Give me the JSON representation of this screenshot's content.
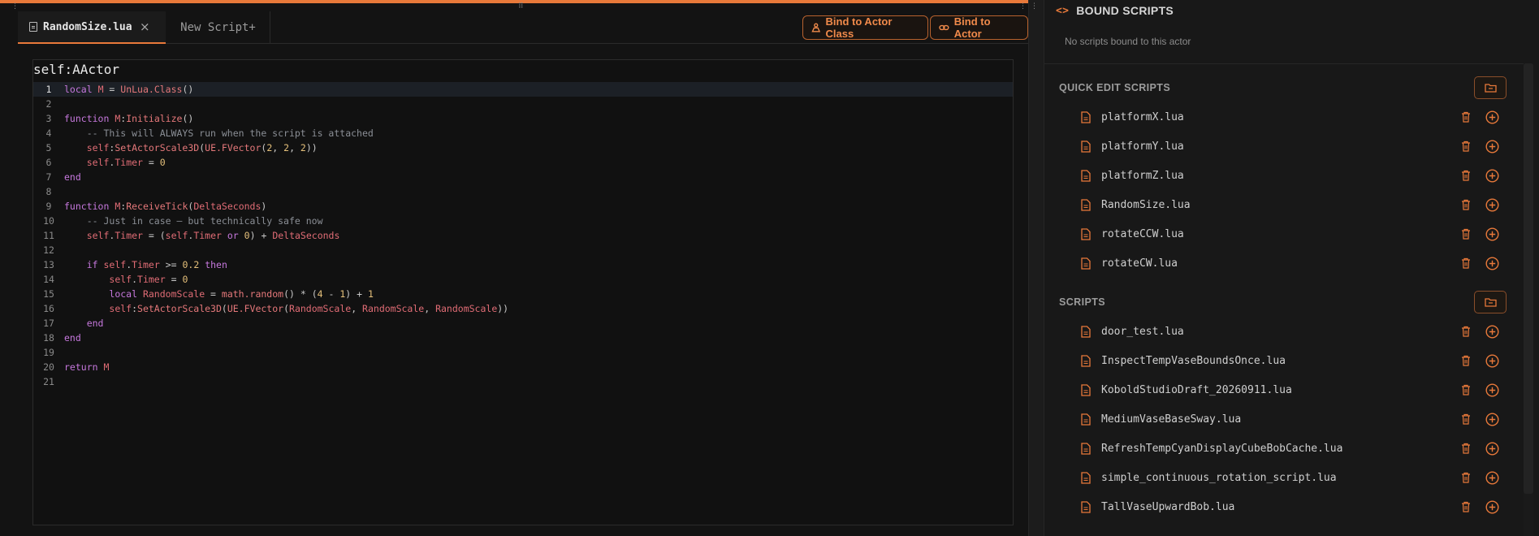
{
  "colors": {
    "accent": "#e8793a",
    "background": "#131313",
    "panel": "#181818"
  },
  "editor": {
    "tabs": [
      {
        "label": "RandomSize.lua",
        "icon": "file-icon",
        "close_glyph": "×"
      },
      {
        "label": "New Script+"
      }
    ],
    "buttons": {
      "bind_class_label": "Bind to Actor Class",
      "bind_actor_label": "Bind to Actor"
    },
    "code_header": "self:AActor",
    "current_line": 1,
    "line_numbers": [
      "1",
      "2",
      "3",
      "4",
      "5",
      "6",
      "7",
      "8",
      "9",
      "10",
      "11",
      "12",
      "13",
      "14",
      "15",
      "16",
      "17",
      "18",
      "19",
      "20",
      "21"
    ]
  },
  "bound_scripts": {
    "title": "BOUND SCRIPTS",
    "title_icon": "code-icon",
    "empty_text": "No scripts bound to this actor"
  },
  "quick_edit": {
    "heading": "QUICK EDIT SCRIPTS",
    "items": [
      "platformX.lua",
      "platformY.lua",
      "platformZ.lua",
      "RandomSize.lua",
      "rotateCCW.lua",
      "rotateCW.lua"
    ]
  },
  "scripts": {
    "heading": "SCRIPTS",
    "items": [
      "door_test.lua",
      "InspectTempVaseBoundsOnce.lua",
      "KoboldStudioDraft_20260911.lua",
      "MediumVaseBaseSway.lua",
      "RefreshTempCyanDisplayCubeBobCache.lua",
      "simple_continuous_rotation_script.lua",
      "TallVaseUpwardBob.lua"
    ]
  }
}
